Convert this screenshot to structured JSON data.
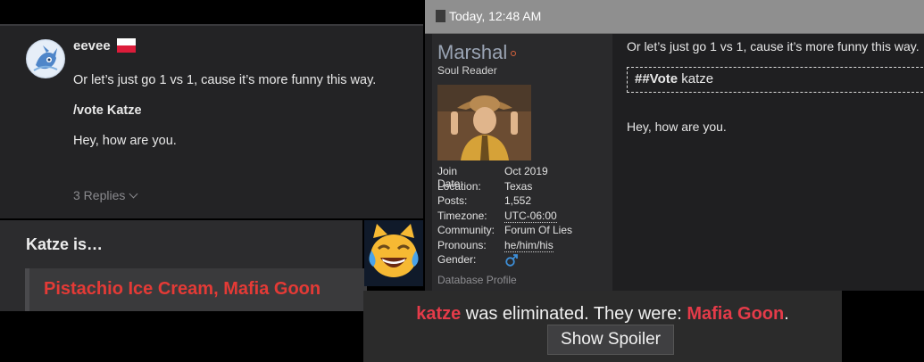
{
  "post_eevee": {
    "username": "eevee",
    "flag": "poland-flag-icon",
    "lines": [
      "Or let’s just go 1 vs 1, cause it’s more funny this way.",
      "/vote Katze",
      "Hey, how are you."
    ],
    "replies_label": "3 Replies"
  },
  "quote_box": {
    "heading": "Katze is…",
    "answer": "Pistachio Ice Cream, Mafia Goon"
  },
  "emoji": "cat-with-tears-of-joy-icon",
  "post_marshal": {
    "timestamp": "Today, 12:48 AM",
    "username": "Marshal",
    "rank": "Soul Reader",
    "info": [
      {
        "key": "Join Date:",
        "value": "Oct 2019"
      },
      {
        "key": "Location:",
        "value": "Texas"
      },
      {
        "key": "Posts:",
        "value": "1,552"
      },
      {
        "key": "Timezone:",
        "value": "UTC-06:00"
      },
      {
        "key": "Community:",
        "value": "Forum Of Lies"
      },
      {
        "key": "Pronouns:",
        "value": "he/him/his"
      },
      {
        "key": "Gender:",
        "value": "male-symbol-icon"
      }
    ],
    "database_profile": "Database Profile",
    "line1": "Or let’s just go 1 vs 1, cause it’s more funny this way.",
    "vote_tag": "##Vote",
    "vote_target": "katze",
    "line3": "Hey, how are you."
  },
  "elimination": {
    "name": "katze",
    "middle": " was eliminated. They were: ",
    "role": "Mafia Goon",
    "end": ".",
    "spoiler_button": "Show Spoiler"
  },
  "colors": {
    "accent_red": "#e43a36",
    "elim_red": "#e53b49",
    "gender_blue": "#3d8fd9"
  }
}
